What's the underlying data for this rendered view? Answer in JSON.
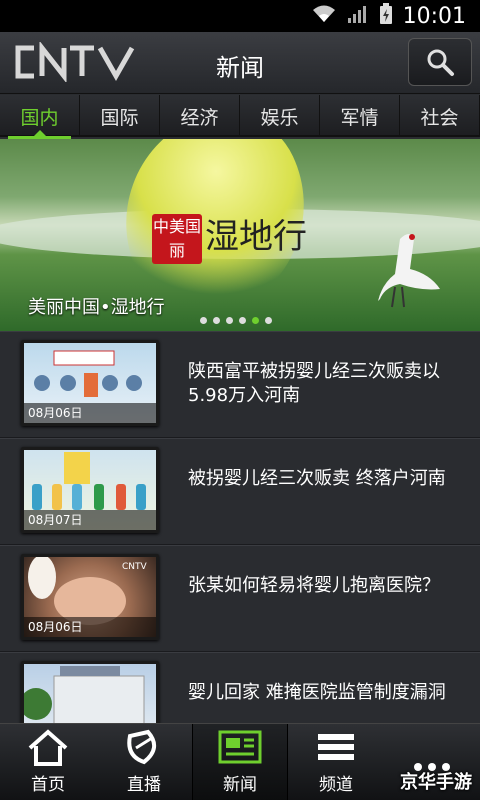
{
  "status_bar": {
    "time": "10:01"
  },
  "header": {
    "logo_text": "CNTV",
    "title": "新闻"
  },
  "tabs": [
    {
      "label": "国内",
      "active": true
    },
    {
      "label": "国际"
    },
    {
      "label": "经济"
    },
    {
      "label": "娱乐"
    },
    {
      "label": "军情"
    },
    {
      "label": "社会"
    }
  ],
  "banner": {
    "caption": "美丽中国•湿地行",
    "seal_text": "中美国丽",
    "art_text": "湿地行",
    "dots": 6,
    "active_dot": 5
  },
  "news": [
    {
      "headline": "陕西富平被拐婴儿经三次贩卖以5.98万入河南",
      "date": "08月06日"
    },
    {
      "headline": "被拐婴儿经三次贩卖 终落户河南",
      "date": "08月07日"
    },
    {
      "headline": "张某如何轻易将婴儿抱离医院？",
      "date": "08月06日"
    },
    {
      "headline": "婴儿回家 难掩医院监管制度漏洞",
      "date": ""
    }
  ],
  "bottom_nav": [
    {
      "label": "首页",
      "icon": "home-icon"
    },
    {
      "label": "直播",
      "icon": "satellite-dish-icon"
    },
    {
      "label": "新闻",
      "icon": "news-icon",
      "active": true
    },
    {
      "label": "频道",
      "icon": "menu-icon"
    },
    {
      "label": "",
      "icon": "more-icon"
    }
  ],
  "watermark": "京华手游",
  "colors": {
    "accent": "#6fcf2e",
    "background": "#2a2c30"
  }
}
